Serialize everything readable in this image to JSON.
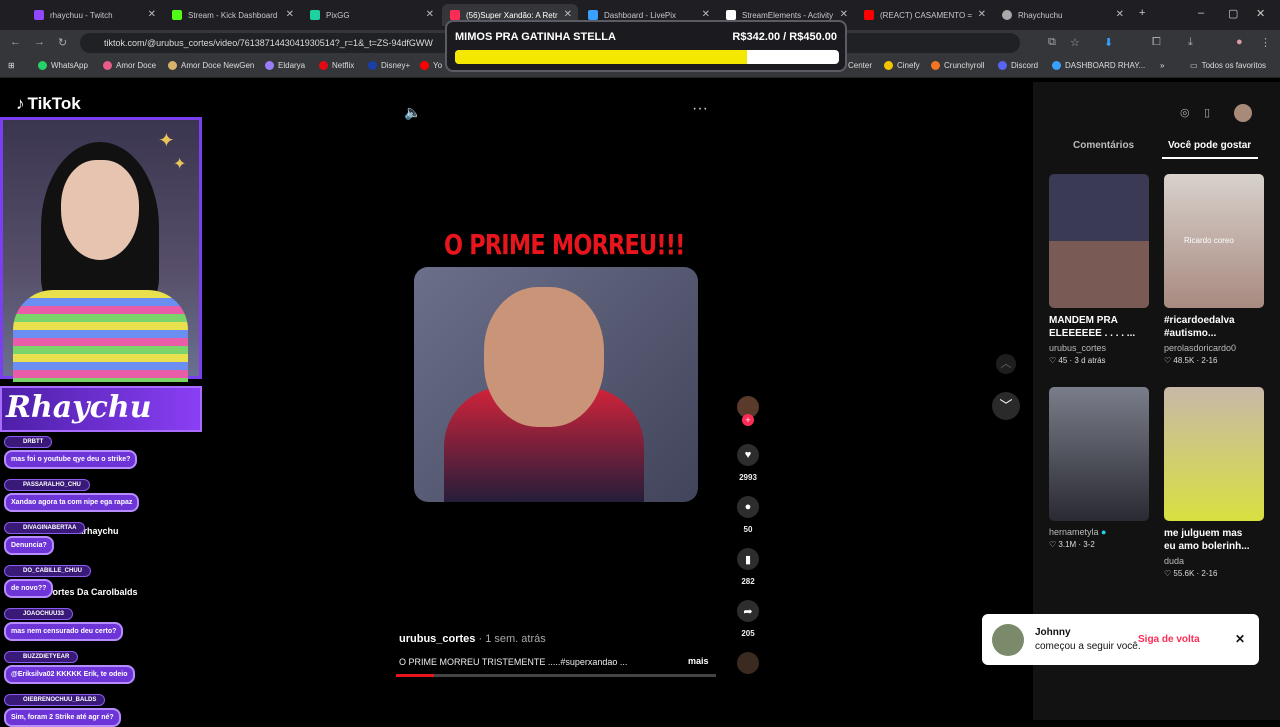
{
  "tabs": [
    {
      "label": "rhaychuu - Twitch",
      "color": "#9146ff"
    },
    {
      "label": "Stream - Kick Dashboard",
      "color": "#53fc18"
    },
    {
      "label": "PixGG",
      "color": "#1fd1a0"
    },
    {
      "label": "(56)Super Xandão: A Retr",
      "color": "#fe2c55"
    },
    {
      "label": "Dashboard - LivePix",
      "color": "#3aa0ff"
    },
    {
      "label": "StreamElements - Activity",
      "color": "#ffffff"
    },
    {
      "label": "(REACT) CASAMENTO = ",
      "color": "#ff0000"
    },
    {
      "label": "Rhaychuchu",
      "color": "#aaaaaa"
    }
  ],
  "window_controls": {
    "new_tab": "+",
    "minimize": "–",
    "maximize": "▢",
    "close": "✕"
  },
  "address": {
    "url": "tiktok.com/@urubus_cortes/video/7613871443041930514?_r=1&_t=ZS-94dfGWW"
  },
  "bookmarks": [
    {
      "label": "WhatsApp",
      "color": "#25d366"
    },
    {
      "label": "Amor Doce",
      "color": "#e85c8a"
    },
    {
      "label": "Amor Doce NewGen",
      "color": "#d8b26a"
    },
    {
      "label": "Eldarya",
      "color": "#9a7cff"
    },
    {
      "label": "Netflix",
      "color": "#e50914"
    },
    {
      "label": "Disney+",
      "color": "#1a3fa8"
    },
    {
      "label": "Yo",
      "color": "#ff0000"
    },
    {
      "label": "Center",
      "color": "#888888"
    },
    {
      "label": "Cinefy",
      "color": "#f2c500"
    },
    {
      "label": "Crunchyroll",
      "color": "#f47521"
    },
    {
      "label": "Discord",
      "color": "#5865f2"
    },
    {
      "label": "DASHBOARD RHAY...",
      "color": "#3aa0ff"
    },
    {
      "label": "Todos os favoritos",
      "color": "#aaaaaa"
    }
  ],
  "goal_overlay": {
    "title": "MIMOS PRA GATINHA STELLA",
    "amount": "R$342.00 / R$450.00",
    "progress": 0.76
  },
  "tiktok": {
    "logo": "TikTok"
  },
  "streamer_banner": {
    "name": "Rhaychu"
  },
  "chat": [
    {
      "user": "DRBTT",
      "msg": "mas foi o youtube qye deu o strike?"
    },
    {
      "user": "PASSARALHO_CHU",
      "msg": "Xandao agora ta com nipe ega rapaz"
    },
    {
      "user": "DIVAGINABERTAA",
      "msg": "Denuncia?"
    },
    {
      "user": "DO_CABILLE_CHUU",
      "msg": "de novo??"
    },
    {
      "user": "JOAOCHUU33",
      "msg": "mas nem censurado deu certo?"
    },
    {
      "user": "BUZZDIETYEAR",
      "msg": "@Eriksilva02 KKKKK Erik, te odeio"
    },
    {
      "user": "OIEBRENOCHUU_BALDS",
      "msg": "Sim, foram 2 Strike até agr né?"
    }
  ],
  "sidebar_fragments": {
    "cortes": "cortesdarhaychu",
    "carol": "Cortes Da Carolbalds"
  },
  "video": {
    "headline": "O PRIME MORREU!!!",
    "author": "urubus_cortes",
    "time": " · 1 sem. atrás",
    "caption": "O PRIME MORREU TRISTEMENTE .....#superxandao ...",
    "more": "mais",
    "likes": "2993",
    "comments": "50",
    "saves": "282",
    "shares": "205"
  },
  "right_panel": {
    "tab_comments": "Comentários",
    "tab_suggest": "Você pode gostar",
    "cards": [
      {
        "title": "MANDEM PRA ELEEEEEE . . . . ...",
        "user": "urubus_cortes",
        "stats": "♡ 45 · 3 d atrás",
        "color": "#6a5a5a"
      },
      {
        "title": "#ricardoedalva #autismo...",
        "user": "perolasdoricardo0",
        "stats": "♡ 48.5K · 2-16",
        "color": "#a88a80",
        "overlay": "Ricardo coreo"
      },
      {
        "title": "",
        "user": "hernametyla",
        "stats": "♡ 3.1M · 3-2",
        "color": "#4a4a52"
      },
      {
        "title": "me julguem mas eu amo bolerinh...",
        "user": "duda",
        "stats": "♡ 55.6K · 2-16",
        "color": "#c8c0a0"
      }
    ]
  },
  "toast": {
    "name": "Johnny",
    "message": "começou a seguir você.",
    "button": "Siga de volta"
  }
}
